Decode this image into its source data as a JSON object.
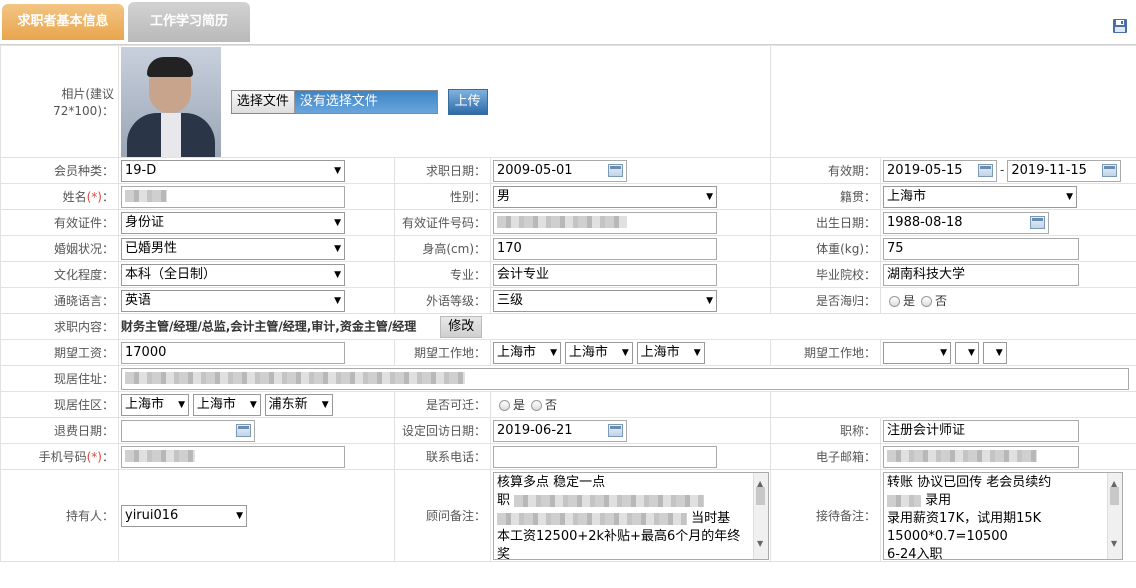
{
  "tabs": {
    "tab1": "求职者基本信息",
    "tab2": "工作学习简历"
  },
  "icons": {
    "save": "save-icon"
  },
  "photo": {
    "label": "相片(建议72*100)：",
    "choose_btn": "选择文件",
    "no_file": "没有选择文件",
    "upload_btn": "上传"
  },
  "member_type": {
    "label": "会员种类：",
    "value": "19-D"
  },
  "job_date": {
    "label": "求职日期：",
    "value": "2009-05-01"
  },
  "valid_period": {
    "label": "有效期：",
    "from": "2019-05-15",
    "sep": "-",
    "to": "2019-11-15"
  },
  "name": {
    "label": "姓名",
    "req": "(*)",
    "colon": "："
  },
  "gender": {
    "label": "性别：",
    "value": "男"
  },
  "native_place": {
    "label": "籍贯：",
    "value": "上海市"
  },
  "id_type": {
    "label": "有效证件：",
    "value": "身份证"
  },
  "id_number": {
    "label": "有效证件号码："
  },
  "birth": {
    "label": "出生日期：",
    "value": "1988-08-18"
  },
  "marital": {
    "label": "婚姻状况：",
    "value": "已婚男性"
  },
  "height": {
    "label": "身高(cm)：",
    "value": "170"
  },
  "weight": {
    "label": "体重(kg)：",
    "value": "75"
  },
  "education": {
    "label": "文化程度：",
    "value": "本科（全日制）"
  },
  "major": {
    "label": "专业：",
    "value": "会计专业"
  },
  "school": {
    "label": "毕业院校：",
    "value": "湖南科技大学"
  },
  "language": {
    "label": "通晓语言：",
    "value": "英语"
  },
  "lang_level": {
    "label": "外语等级：",
    "value": "三级"
  },
  "overseas": {
    "label": "是否海归：",
    "yes": "是",
    "no": "否"
  },
  "job_content": {
    "label": "求职内容：",
    "value": "财务主管/经理/总监,会计主管/经理,审计,资金主管/经理",
    "edit_btn": "修改"
  },
  "salary": {
    "label": "期望工资：",
    "value": "17000"
  },
  "work_place": {
    "label": "期望工作地：",
    "v1": "上海市",
    "v2": "上海市",
    "v3": "上海市"
  },
  "work_place2": {
    "label": "期望工作地："
  },
  "address": {
    "label": "现居住址："
  },
  "district": {
    "label": "现居住区：",
    "v1": "上海市",
    "v2": "上海市",
    "v3": "浦东新"
  },
  "relocate": {
    "label": "是否可迁：",
    "yes": "是",
    "no": "否"
  },
  "refund_date": {
    "label": "退费日期："
  },
  "revisit_date": {
    "label": "设定回访日期：",
    "value": "2019-06-21"
  },
  "title": {
    "label": "职称：",
    "value": "注册会计师证"
  },
  "mobile": {
    "label": "手机号码",
    "req": "(*)",
    "colon": "："
  },
  "phone": {
    "label": "联系电话："
  },
  "email": {
    "label": "电子邮箱："
  },
  "holder": {
    "label": "持有人：",
    "value": "yirui016"
  },
  "consultant_note": {
    "label": "顾问备注：",
    "l1": "核算多点  稳定一点",
    "l2": "职 ",
    "l3": "当时基",
    "l4": "本工资12500+2k补贴+最高6个月的年终奖"
  },
  "reception_note": {
    "label": "接待备注：",
    "l1": "转账 协议已回传 老会员续约",
    "l2": "录用",
    "l3": "录用薪资17K，试用期15K",
    "l4": "15000*0.7=10500",
    "l5": "6-24入职"
  }
}
